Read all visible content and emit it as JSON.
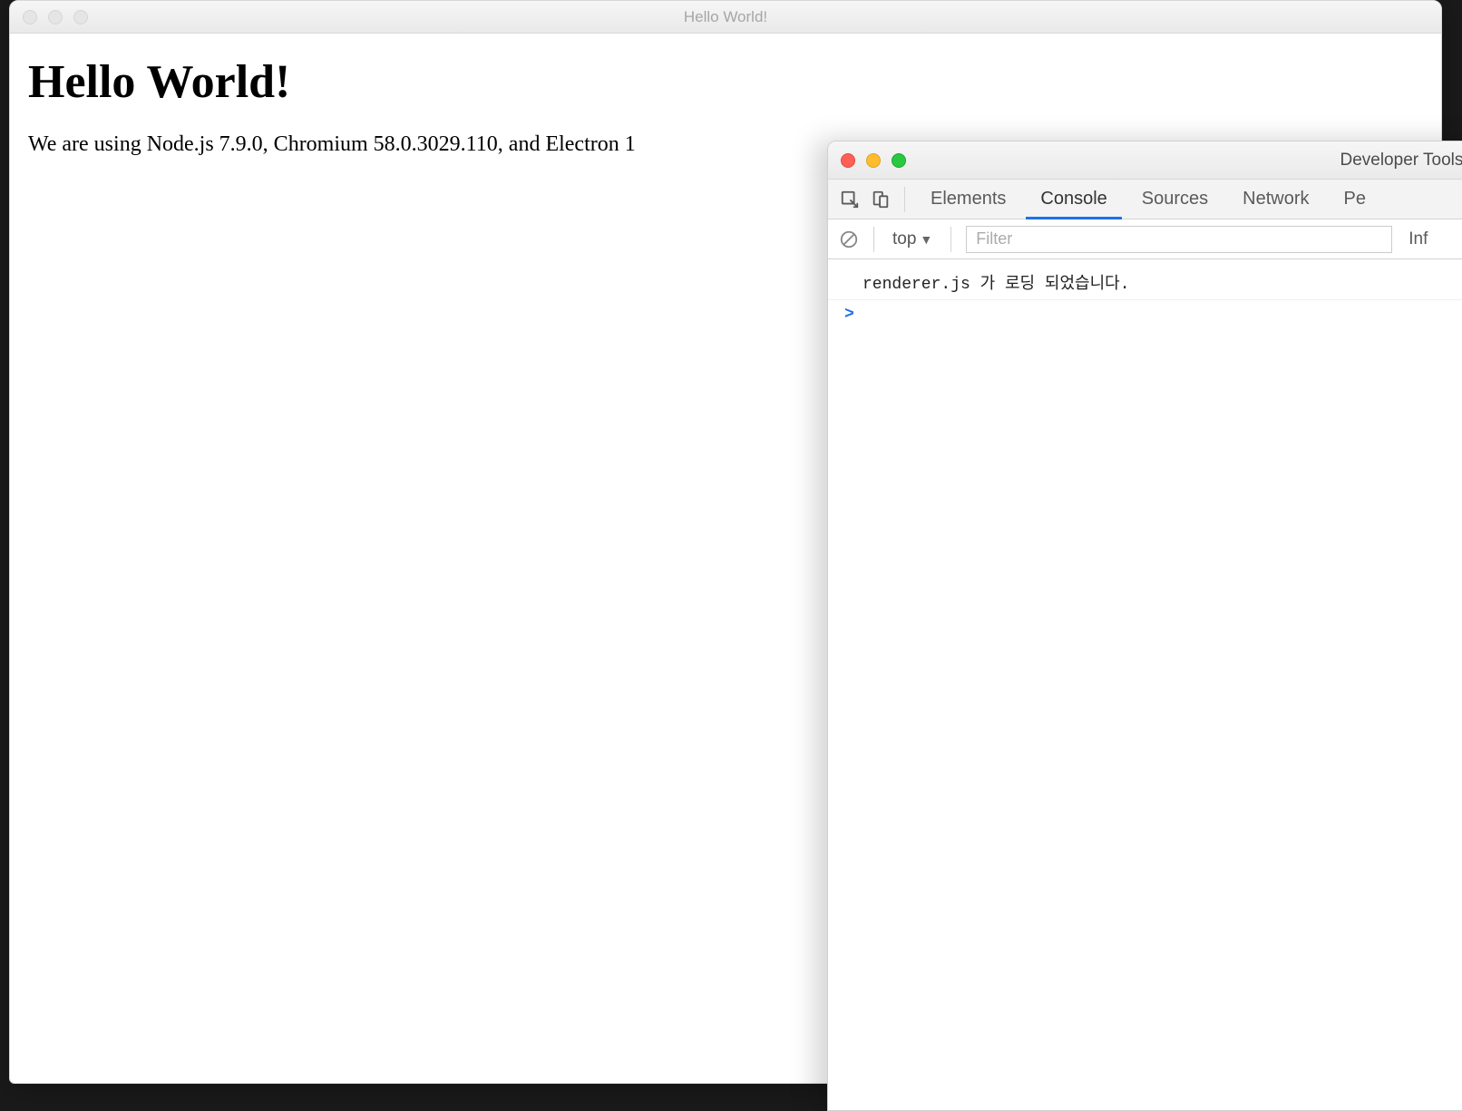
{
  "app_window": {
    "title": "Hello World!",
    "heading": "Hello World!",
    "body_text": "We are using Node.js 7.9.0, Chromium 58.0.3029.110, and Electron 1"
  },
  "devtools": {
    "title": "Developer Tools - ",
    "tabs": {
      "elements": "Elements",
      "console": "Console",
      "sources": "Sources",
      "network": "Network",
      "performance": "Pe"
    },
    "toolbar": {
      "context": "top",
      "filter_placeholder": "Filter",
      "level": "Inf"
    },
    "console": {
      "log1": "renderer.js 가 로딩 되었습니다.",
      "prompt": ">"
    }
  }
}
